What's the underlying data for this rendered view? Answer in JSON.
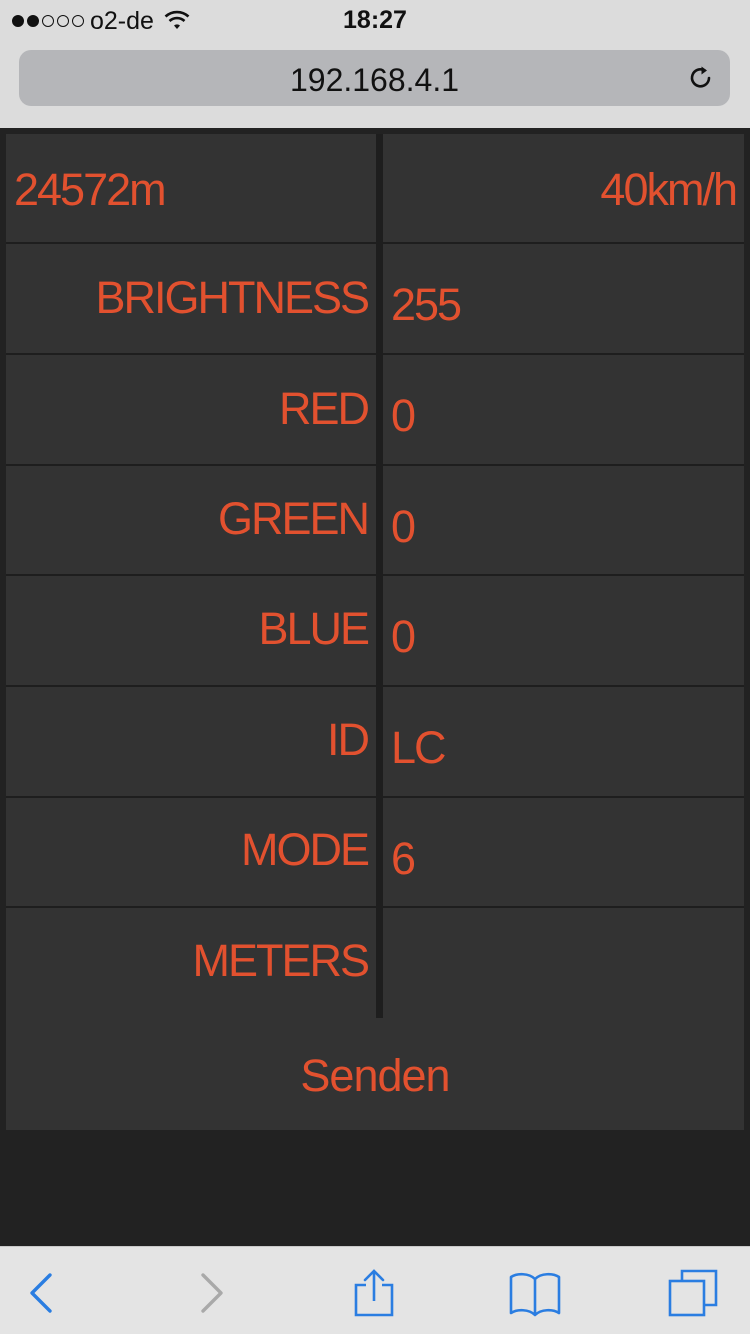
{
  "status": {
    "carrier": "o2-de",
    "signal_bars": 2,
    "signal_total": 5,
    "time": "18:27"
  },
  "browser": {
    "url": "192.168.4.1"
  },
  "readouts": {
    "distance": "24572m",
    "speed": "40km/h"
  },
  "settings": [
    {
      "label": "BRIGHTNESS",
      "value": "255"
    },
    {
      "label": "RED",
      "value": "0"
    },
    {
      "label": "GREEN",
      "value": "0"
    },
    {
      "label": "BLUE",
      "value": "0"
    },
    {
      "label": "ID",
      "value": "LC"
    },
    {
      "label": "MODE",
      "value": "6"
    },
    {
      "label": "METERS",
      "value": ""
    }
  ],
  "send_label": "Senden",
  "colors": {
    "accent": "#e2512f",
    "cell_bg": "#333333",
    "page_bg": "#222222",
    "chrome_bg": "#dcdcdc",
    "toolbar_icon": "#2a7de1"
  },
  "toolbar_icons": [
    "back-icon",
    "forward-icon",
    "share-icon",
    "bookmarks-icon",
    "tabs-icon"
  ]
}
